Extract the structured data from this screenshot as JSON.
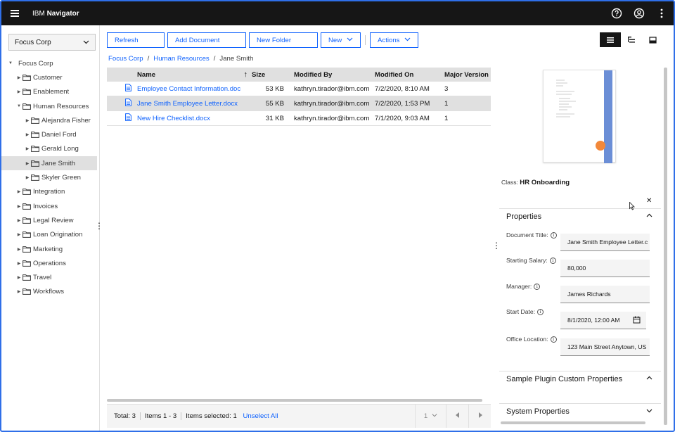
{
  "header": {
    "brand_prefix": "IBM",
    "brand_name": "Navigator",
    "icons": [
      "menu-icon",
      "help-icon",
      "user-icon",
      "overflow-menu-icon"
    ]
  },
  "repository": {
    "selected": "Focus Corp"
  },
  "tree": {
    "root": "Focus Corp",
    "items": [
      {
        "label": "Customer",
        "level": 1,
        "expanded": false,
        "selected": false
      },
      {
        "label": "Enablement",
        "level": 1,
        "expanded": false,
        "selected": false
      },
      {
        "label": "Human Resources",
        "level": 1,
        "expanded": true,
        "selected": false
      },
      {
        "label": "Alejandra Fisher",
        "level": 2,
        "expanded": false,
        "selected": false
      },
      {
        "label": "Daniel Ford",
        "level": 2,
        "expanded": false,
        "selected": false
      },
      {
        "label": "Gerald Long",
        "level": 2,
        "expanded": false,
        "selected": false
      },
      {
        "label": "Jane Smith",
        "level": 2,
        "expanded": false,
        "selected": true
      },
      {
        "label": "Skyler Green",
        "level": 2,
        "expanded": false,
        "selected": false
      },
      {
        "label": "Integration",
        "level": 1,
        "expanded": false,
        "selected": false
      },
      {
        "label": "Invoices",
        "level": 1,
        "expanded": false,
        "selected": false
      },
      {
        "label": "Legal Review",
        "level": 1,
        "expanded": false,
        "selected": false
      },
      {
        "label": "Loan Origination",
        "level": 1,
        "expanded": false,
        "selected": false
      },
      {
        "label": "Marketing",
        "level": 1,
        "expanded": false,
        "selected": false
      },
      {
        "label": "Operations",
        "level": 1,
        "expanded": false,
        "selected": false
      },
      {
        "label": "Travel",
        "level": 1,
        "expanded": false,
        "selected": false
      },
      {
        "label": "Workflows",
        "level": 1,
        "expanded": false,
        "selected": false
      }
    ]
  },
  "toolbar": {
    "refresh": "Refresh",
    "add_document": "Add Document",
    "new_folder": "New Folder",
    "new": "New",
    "actions": "Actions"
  },
  "breadcrumb": {
    "items": [
      "Focus Corp",
      "Human Resources"
    ],
    "current": "Jane Smith"
  },
  "grid": {
    "columns": {
      "name": "Name",
      "size": "Size",
      "modified_by": "Modified By",
      "modified_on": "Modified On",
      "major_version": "Major Version"
    },
    "rows": [
      {
        "name": "Employee Contact Information.doc",
        "size": "53 KB",
        "modified_by": "kathryn.tirador@ibm.com",
        "modified_on": "7/2/2020, 8:10 AM",
        "version": "3",
        "selected": false
      },
      {
        "name": "Jane Smith Employee Letter.docx",
        "size": "55 KB",
        "modified_by": "kathryn.tirador@ibm.com",
        "modified_on": "7/2/2020, 1:53 PM",
        "version": "1",
        "selected": true
      },
      {
        "name": "New Hire Checklist.docx",
        "size": "31 KB",
        "modified_by": "kathryn.tirador@ibm.com",
        "modified_on": "7/1/2020, 9:03 AM",
        "version": "1",
        "selected": false
      }
    ]
  },
  "footer": {
    "total": "Total: 3",
    "items_range": "Items 1 - 3",
    "items_selected": "Items selected: 1",
    "unselect_all": "Unselect All",
    "page": "1"
  },
  "properties": {
    "class_label": "Class:",
    "class_value": "HR Onboarding",
    "section_title": "Properties",
    "fields": [
      {
        "label": "Document Title:",
        "value": "Jane Smith Employee Letter.c"
      },
      {
        "label": "Starting Salary:",
        "value": "80,000"
      },
      {
        "label": "Manager:",
        "value": "James Richards"
      },
      {
        "label": "Start Date:",
        "value": "8/1/2020, 12:00 AM"
      },
      {
        "label": "Office Location:",
        "value": "123 Main Street Anytown, US"
      }
    ],
    "plugin_section": "Sample Plugin Custom Properties",
    "system_section": "System Properties"
  },
  "colors": {
    "accent": "#0f62fe",
    "header_bg": "#161616",
    "selected_row": "#e0e0e0",
    "thumb_band": "#6b8ed6",
    "thumb_dot": "#f2883a"
  }
}
